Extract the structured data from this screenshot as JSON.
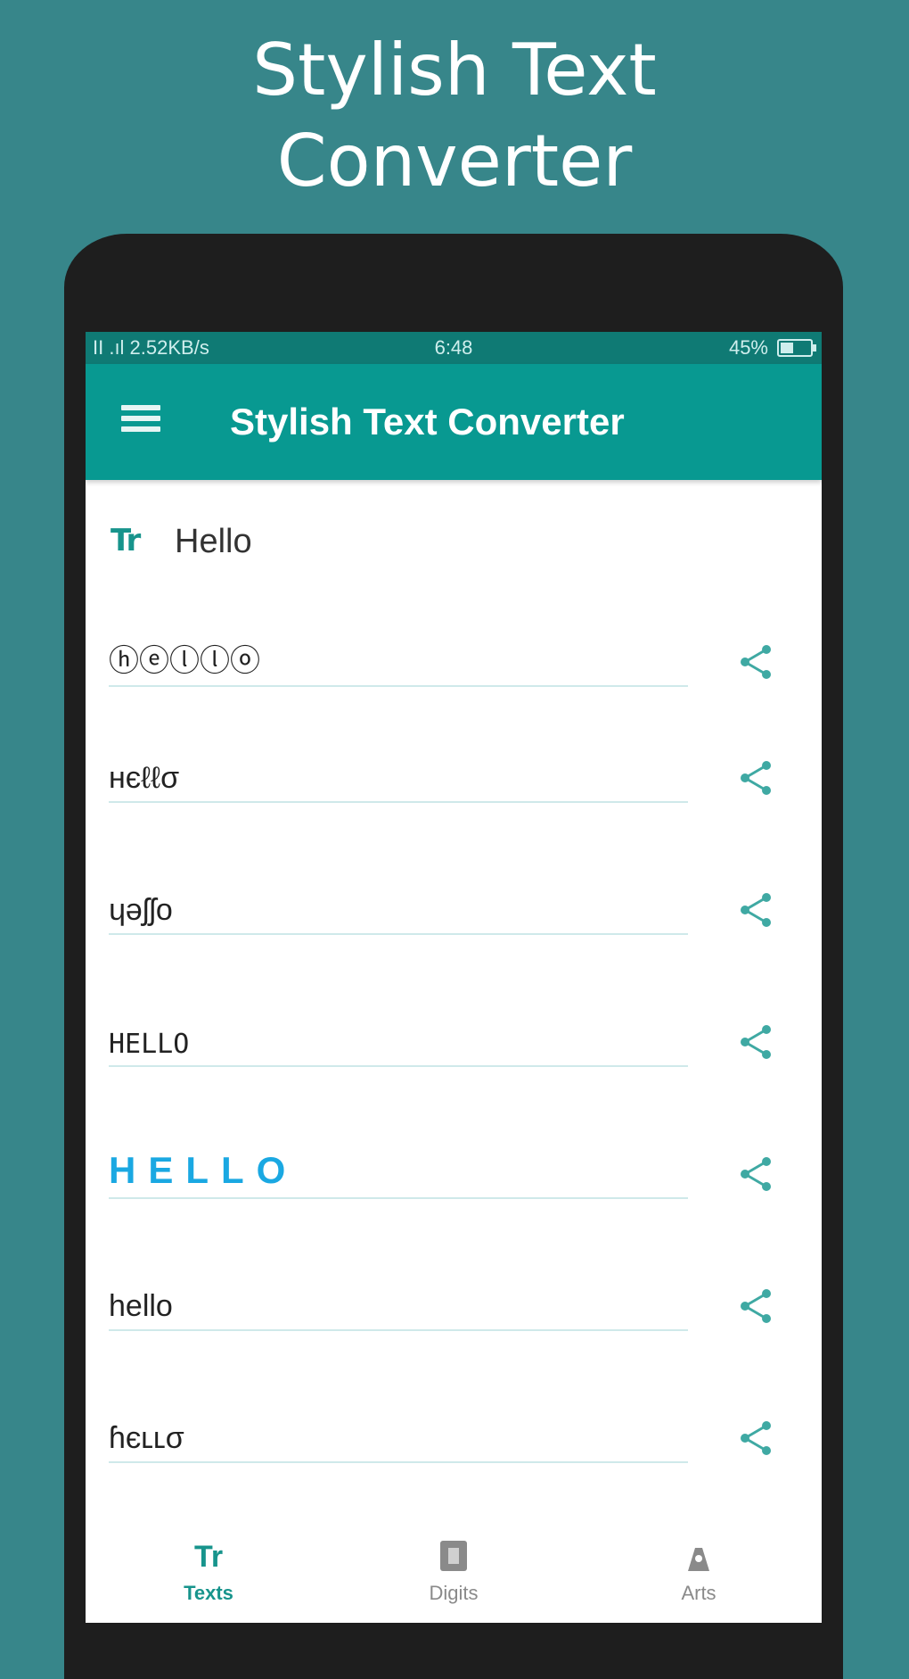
{
  "promo": {
    "title_line1": "Stylish Text",
    "title_line2": "Converter"
  },
  "status_bar": {
    "left": "ΙΙ .ıl 2.52KB/s",
    "time": "6:48",
    "battery": "45%"
  },
  "toolbar": {
    "menu_icon": "hamburger-menu-icon",
    "title": "Stylish Text Converter"
  },
  "input": {
    "icon": "Tr",
    "value": "Hello"
  },
  "styles": [
    {
      "text": "ⓗⓔⓛⓛⓞ",
      "icon": "share-icon"
    },
    {
      "text": "нєℓℓσ",
      "icon": "share-icon"
    },
    {
      "text": "ɥǝʃʃo",
      "icon": "share-icon"
    },
    {
      "text": "HELLO",
      "icon": "share-icon"
    },
    {
      "text": "HELLO",
      "icon": "share-icon"
    },
    {
      "text": "hello",
      "icon": "share-icon"
    },
    {
      "text": "ɦєʟʟσ",
      "icon": "share-icon"
    }
  ],
  "bottom_nav": [
    {
      "icon": "Tr",
      "label": "Texts",
      "active": true
    },
    {
      "icon": "digits-icon",
      "label": "Digits",
      "active": false
    },
    {
      "icon": "arts-icon",
      "label": "Arts",
      "active": false
    }
  ],
  "colors": {
    "background": "#37868a",
    "accent": "#089991",
    "status_bar": "#0f7a74",
    "blue_style": "#1aa8e2"
  }
}
